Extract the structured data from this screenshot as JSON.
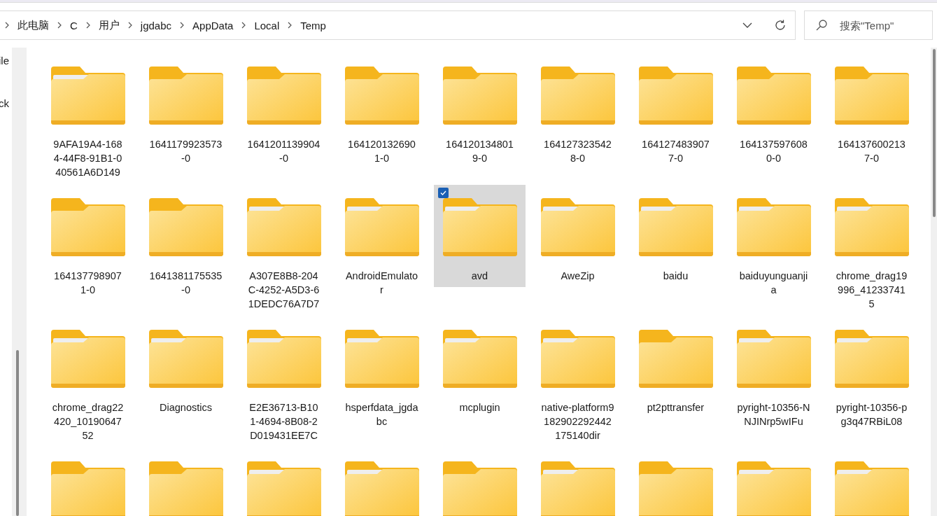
{
  "address_bar": {
    "breadcrumbs": [
      "此电脑",
      "C",
      "用户",
      "jgdabc",
      "AppData",
      "Local",
      "Temp"
    ]
  },
  "search": {
    "placeholder": "搜索\"Temp\""
  },
  "navigation_pane": {
    "items": [
      "ile",
      "ck"
    ]
  },
  "folders": [
    {
      "name": "9AFA19A4-1684-44F8-91B1-040561A6D149",
      "has_files": true,
      "selected": false
    },
    {
      "name": "1641179923573-0",
      "has_files": false,
      "selected": false
    },
    {
      "name": "1641201139904-0",
      "has_files": false,
      "selected": false
    },
    {
      "name": "1641201326901-0",
      "has_files": false,
      "selected": false
    },
    {
      "name": "1641201348019-0",
      "has_files": false,
      "selected": false
    },
    {
      "name": "1641273235428-0",
      "has_files": false,
      "selected": false
    },
    {
      "name": "1641274839077-0",
      "has_files": false,
      "selected": false
    },
    {
      "name": "1641375976080-0",
      "has_files": false,
      "selected": false
    },
    {
      "name": "1641376002137-0",
      "has_files": false,
      "selected": false
    },
    {
      "name": "1641377989071-0",
      "has_files": false,
      "selected": false
    },
    {
      "name": "1641381175535-0",
      "has_files": false,
      "selected": false
    },
    {
      "name": "A307E8B8-204C-4252-A5D3-61DEDC76A7D7",
      "has_files": true,
      "selected": false
    },
    {
      "name": "AndroidEmulator",
      "has_files": true,
      "selected": false
    },
    {
      "name": "avd",
      "has_files": true,
      "selected": true
    },
    {
      "name": "AweZip",
      "has_files": true,
      "selected": false
    },
    {
      "name": "baidu",
      "has_files": true,
      "selected": false
    },
    {
      "name": "baiduyunguanjia",
      "has_files": true,
      "selected": false
    },
    {
      "name": "chrome_drag19996_412337415",
      "has_files": true,
      "selected": false
    },
    {
      "name": "chrome_drag22420_1019064752",
      "has_files": true,
      "selected": false
    },
    {
      "name": "Diagnostics",
      "has_files": true,
      "selected": false
    },
    {
      "name": "E2E36713-B101-4694-8B08-2D019431EE7C",
      "has_files": true,
      "selected": false
    },
    {
      "name": "hsperfdata_jgdabc",
      "has_files": true,
      "selected": false
    },
    {
      "name": "mcplugin",
      "has_files": true,
      "selected": false
    },
    {
      "name": "native-platform9182902292442175140dir",
      "has_files": true,
      "selected": false
    },
    {
      "name": "pt2pttransfer",
      "has_files": false,
      "selected": false
    },
    {
      "name": "pyright-10356-NNJINrp5wIFu",
      "has_files": true,
      "selected": false
    },
    {
      "name": "pyright-10356-pg3q47RBiL08",
      "has_files": true,
      "selected": false
    },
    {
      "has_files": false,
      "selected": false
    },
    {
      "has_files": false,
      "selected": false
    },
    {
      "has_files": true,
      "selected": false
    },
    {
      "has_files": true,
      "selected": false
    },
    {
      "has_files": false,
      "selected": false
    },
    {
      "has_files": true,
      "selected": false
    },
    {
      "has_files": false,
      "selected": false
    },
    {
      "has_files": true,
      "selected": false
    },
    {
      "has_files": true,
      "selected": false
    }
  ]
}
